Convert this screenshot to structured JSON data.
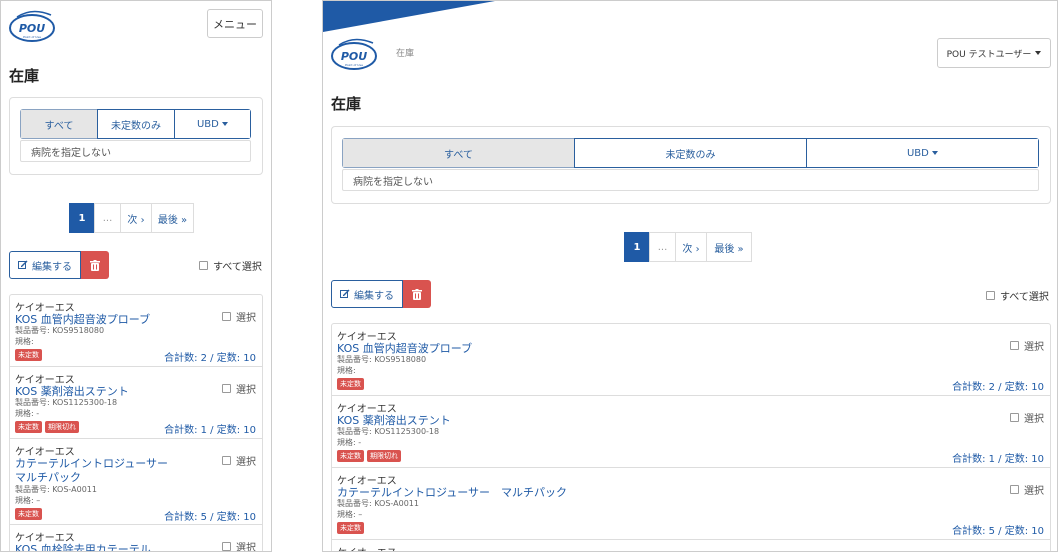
{
  "mobile": {
    "menu_label": "メニュー",
    "heading": "在庫",
    "filters": [
      "すべて",
      "未定数のみ",
      "UBD"
    ],
    "hospital": "病院を指定しない",
    "pager": [
      "1",
      "...",
      "次 ›",
      "最後 »"
    ],
    "edit_label": "編集する",
    "select_all": "すべて選択",
    "items": [
      {
        "maker": "ケイオーエス",
        "name": "KOS 血管内超音波プローブ",
        "pn": "製品番号: KOS9518080",
        "spec": "規格:",
        "badges": [
          "未定数"
        ],
        "select": "選択",
        "total": "合計数: 2 / 定数: 10"
      },
      {
        "maker": "ケイオーエス",
        "name": "KOS 薬剤溶出ステント",
        "pn": "製品番号: KOS1125300-18",
        "spec": "規格: -",
        "badges": [
          "未定数",
          "期限切れ"
        ],
        "select": "選択",
        "total": "合計数: 1 / 定数: 10"
      },
      {
        "maker": "ケイオーエス",
        "name": "カテーテルイントロジューサー",
        "name2": "マルチパック",
        "pn": "製品番号: KOS-A0011",
        "spec": "規格: –",
        "badges": [
          "未定数"
        ],
        "select": "選択",
        "total": "合計数: 5 / 定数: 10"
      },
      {
        "maker": "ケイオーエス",
        "name": "KOS 血栓除去用カテーテル",
        "select": "選択"
      }
    ]
  },
  "desktop": {
    "crumb": "在庫",
    "user_label": "POU テストユーザー",
    "heading": "在庫",
    "filters": [
      "すべて",
      "未定数のみ",
      "UBD"
    ],
    "hospital": "病院を指定しない",
    "pager": [
      "1",
      "...",
      "次 ›",
      "最後 »"
    ],
    "edit_label": "編集する",
    "select_all": "すべて選択",
    "items": [
      {
        "maker": "ケイオーエス",
        "name": "KOS 血管内超音波プローブ",
        "pn": "製品番号: KOS9518080",
        "spec": "規格:",
        "badges": [
          "未定数"
        ],
        "select": "選択",
        "total": "合計数: 2 / 定数: 10"
      },
      {
        "maker": "ケイオーエス",
        "name": "KOS 薬剤溶出ステント",
        "pn": "製品番号: KOS1125300-18",
        "spec": "規格: -",
        "badges": [
          "未定数",
          "期限切れ"
        ],
        "select": "選択",
        "total": "合計数: 1 / 定数: 10"
      },
      {
        "maker": "ケイオーエス",
        "name": "カテーテルイントロジューサー　マルチパック",
        "pn": "製品番号: KOS-A0011",
        "spec": "規格: –",
        "badges": [
          "未定数"
        ],
        "select": "選択",
        "total": "合計数: 5 / 定数: 10"
      },
      {
        "maker": "ケイオーエス"
      }
    ]
  },
  "logo_text": "POU",
  "logo_sub": "Point of Use",
  "colors": {
    "primary": "#1f5aa6",
    "danger": "#d9534f",
    "border": "#dddddd"
  },
  "icons": {
    "edit": "edit-icon",
    "trash": "trash-icon",
    "caret": "caret-down-icon"
  }
}
